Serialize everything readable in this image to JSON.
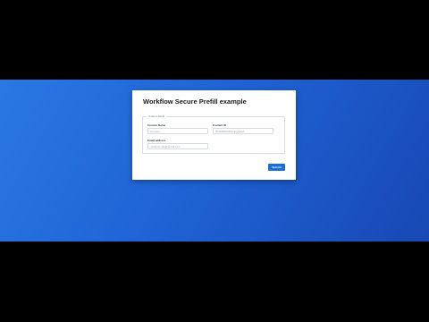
{
  "form": {
    "title": "Workflow Secure Prefill example",
    "section_legend": "Custom fields",
    "fields": [
      {
        "label": "Custom Name",
        "placeholder": "Carmen"
      },
      {
        "label": "Contact ID",
        "placeholder": "003AB000004mpgdAAA"
      },
      {
        "label": "Email address",
        "placeholder": "mailexample@email.com"
      }
    ],
    "submit_label": "Submit"
  },
  "colors": {
    "background_top": "#2a78e4",
    "background_bottom": "#1848b4",
    "letterbox": "#000000",
    "button": "#1b6fd6"
  }
}
